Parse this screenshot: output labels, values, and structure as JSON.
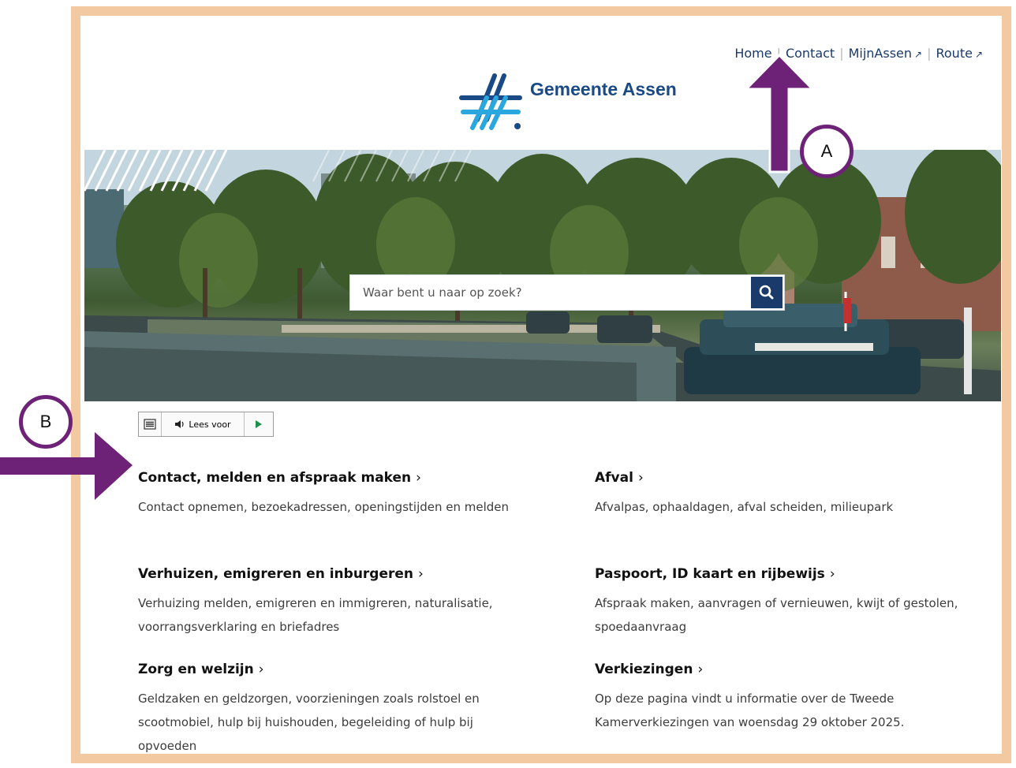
{
  "nav": {
    "items": [
      {
        "label": "Home"
      },
      {
        "label": "Contact"
      },
      {
        "label": "MijnAssen"
      },
      {
        "label": "Route"
      }
    ],
    "separator": "|",
    "external_icon": "external-link-icon"
  },
  "logo": {
    "name": "Gemeente Assen"
  },
  "search": {
    "placeholder": "Waar bent u naar op zoek?",
    "button_icon": "search-icon"
  },
  "readspeaker": {
    "menu_icon": "menu-icon",
    "label": "Lees voor",
    "play_icon": "play-icon"
  },
  "topics": [
    {
      "title": "Contact, melden en afspraak maken",
      "description": "Contact opnemen, bezoekadressen, openingstijden en melden"
    },
    {
      "title": "Afval",
      "description": "Afvalpas, ophaaldagen, afval scheiden, milieupark"
    },
    {
      "title": "Verhuizen, emigreren en inburgeren",
      "description": "Verhuizing melden, emigreren en immigreren, naturalisatie, voorrangsverklaring en briefadres"
    },
    {
      "title": "Paspoort, ID kaart en rijbewijs",
      "description": "Afspraak maken, aanvragen of vernieuwen, kwijt of gestolen, spoedaanvraag"
    },
    {
      "title": "Zorg en welzijn",
      "description": "Geldzaken en geldzorgen, voorzieningen zoals rolstoel en scootmobiel, hulp bij huishouden, begeleiding of hulp bij opvoeden"
    },
    {
      "title": "Verkiezingen",
      "description": "Op deze pagina vindt u informatie over de Tweede Kamerverkiezingen van woensdag 29 oktober 2025."
    }
  ],
  "annotations": {
    "a_label": "A",
    "b_label": "B",
    "arrow_color": "#6e2277"
  },
  "colors": {
    "frame": "#f2c9a0",
    "brand": "#1a3a6b",
    "logo_light": "#2aa7df"
  }
}
